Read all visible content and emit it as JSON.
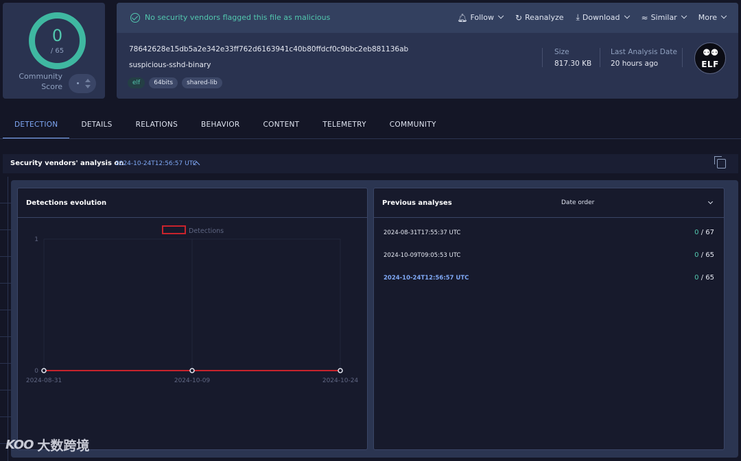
{
  "score": {
    "detected": "0",
    "total": "/ 65",
    "community_label_line1": "Community",
    "community_label_line2": "Score",
    "ring_color": "#3fb8a1"
  },
  "file": {
    "status": "No security vendors flagged this file as malicious",
    "hash": "78642628e15db5a2e342e33ff762d6163941c40b80ffdcf0c9bbc2eb881136ab",
    "name": "suspicious-sshd-binary",
    "tags": [
      "elf",
      "64bits",
      "shared-lib"
    ],
    "size_label": "Size",
    "size_value": "817.30 KB",
    "last_analysis_label": "Last Analysis Date",
    "last_analysis_value": "20 hours ago",
    "type_badge": "ELF",
    "accent_color": "#52c7ae"
  },
  "actions": {
    "follow": "Follow",
    "reanalyze": "Reanalyze",
    "download": "Download",
    "similar": "Similar",
    "more": "More"
  },
  "tabs": [
    {
      "label": "DETECTION",
      "active": true
    },
    {
      "label": "DETAILS",
      "active": false
    },
    {
      "label": "RELATIONS",
      "active": false
    },
    {
      "label": "BEHAVIOR",
      "active": false
    },
    {
      "label": "CONTENT",
      "active": false
    },
    {
      "label": "TELEMETRY",
      "active": false
    },
    {
      "label": "COMMUNITY",
      "active": false
    }
  ],
  "section": {
    "title": "Security vendors' analysis on",
    "date": "2024-10-24T12:56:57 UTC"
  },
  "evolution": {
    "title": "Detections evolution"
  },
  "chart_data": {
    "type": "line",
    "title": "",
    "x": [
      "2024-08-31",
      "2024-10-09",
      "2024-10-24"
    ],
    "series": [
      {
        "name": "Detections",
        "values": [
          0,
          0,
          0
        ],
        "color": "#c8232c"
      }
    ],
    "ylim": [
      0,
      1
    ],
    "yticks": [
      "0",
      "1"
    ],
    "grid": true,
    "legend": "top"
  },
  "previous": {
    "title": "Previous analyses",
    "sort_label": "Date order",
    "rows": [
      {
        "date": "2024-08-31T17:55:37 UTC",
        "detected": "0",
        "total": " / 67",
        "current": false
      },
      {
        "date": "2024-10-09T09:05:53 UTC",
        "detected": "0",
        "total": " / 65",
        "current": false
      },
      {
        "date": "2024-10-24T12:56:57 UTC",
        "detected": "0",
        "total": " / 65",
        "current": true
      }
    ]
  },
  "watermark": {
    "logo": "KOO",
    "text": "大数跨境"
  }
}
